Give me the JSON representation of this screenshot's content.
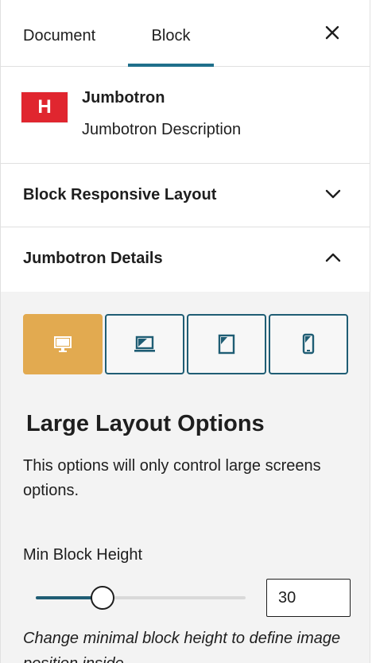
{
  "tabs": [
    {
      "label": "Document"
    },
    {
      "label": "Block"
    }
  ],
  "close_icon": "close-icon",
  "block": {
    "icon_letter": "H",
    "icon_color": "#e0262f",
    "name": "Jumbotron",
    "description": "Jumbotron Description"
  },
  "panels": {
    "responsive_layout": {
      "label": "Block Responsive Layout",
      "expanded": false
    },
    "details": {
      "label": "Jumbotron Details",
      "expanded": true
    }
  },
  "devices": [
    {
      "name": "desktop",
      "icon": "desktop-icon",
      "active": true
    },
    {
      "name": "laptop",
      "icon": "laptop-icon",
      "active": false
    },
    {
      "name": "tablet",
      "icon": "tablet-icon",
      "active": false
    },
    {
      "name": "mobile",
      "icon": "mobile-icon",
      "active": false
    }
  ],
  "colors": {
    "accent": "#e2aa50",
    "primary": "#1f5d74",
    "tab_indicator": "#1f6f8b"
  },
  "layout": {
    "title": "Large Layout Options",
    "description": "This options will only control large screens options."
  },
  "min_block_height": {
    "label": "Min Block Height",
    "value": "30",
    "slider_fraction": 0.27,
    "help": "Change minimal block height to define image position inside"
  }
}
